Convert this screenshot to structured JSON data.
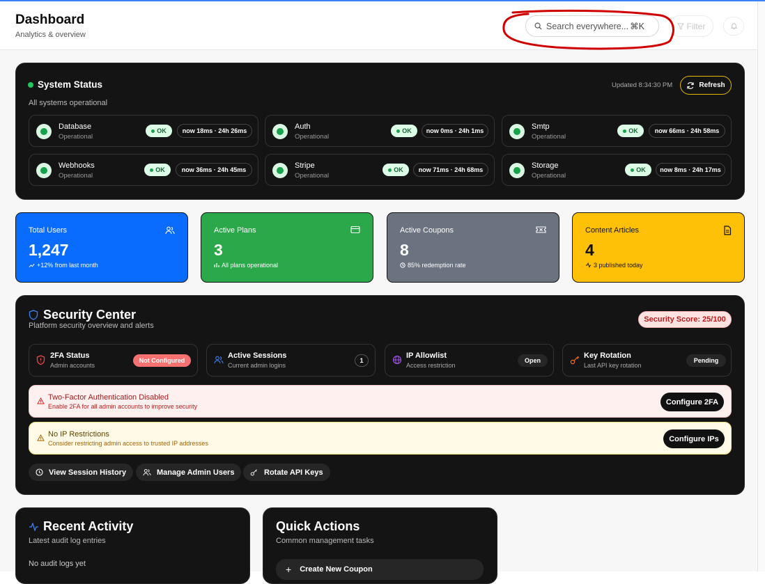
{
  "header": {
    "title": "Dashboard",
    "subtitle": "Analytics & overview",
    "search_placeholder": "Search everywhere...",
    "search_shortcut": "⌘K",
    "filter_label": "Filter"
  },
  "system_status": {
    "title": "System Status",
    "subtitle": "All systems operational",
    "updated": "Updated 8:34:30 PM",
    "refresh_label": "Refresh",
    "services": [
      {
        "name": "Database",
        "status": "Operational",
        "badge": "OK",
        "latency": "now 18ms · 24h 26ms"
      },
      {
        "name": "Auth",
        "status": "Operational",
        "badge": "OK",
        "latency": "now 0ms · 24h 1ms"
      },
      {
        "name": "Smtp",
        "status": "Operational",
        "badge": "OK",
        "latency": "now 66ms · 24h 58ms"
      },
      {
        "name": "Webhooks",
        "status": "Operational",
        "badge": "OK",
        "latency": "now 36ms · 24h 45ms"
      },
      {
        "name": "Stripe",
        "status": "Operational",
        "badge": "OK",
        "latency": "now 71ms · 24h 68ms"
      },
      {
        "name": "Storage",
        "status": "Operational",
        "badge": "OK",
        "latency": "now 8ms · 24h 17ms"
      }
    ]
  },
  "stats": [
    {
      "label": "Total Users",
      "value": "1,247",
      "footer": "+12% from last month",
      "icon": "users-icon",
      "color": "#0a6cff"
    },
    {
      "label": "Active Plans",
      "value": "3",
      "footer": "All plans operational",
      "icon": "credit-card-icon",
      "color": "#2aa84a"
    },
    {
      "label": "Active Coupons",
      "value": "8",
      "footer": "85% redemption rate",
      "icon": "ticket-icon",
      "color": "#6b7280"
    },
    {
      "label": "Content Articles",
      "value": "4",
      "footer": "3 published today",
      "icon": "document-icon",
      "color": "#ffc107"
    }
  ],
  "security": {
    "title": "Security Center",
    "subtitle": "Platform security overview and alerts",
    "score": "Security Score: 25/100",
    "tiles": [
      {
        "title": "2FA Status",
        "sub": "Admin accounts",
        "badge": "Not Configured"
      },
      {
        "title": "Active Sessions",
        "sub": "Current admin logins",
        "badge": "1"
      },
      {
        "title": "IP Allowlist",
        "sub": "Access restriction",
        "badge": "Open"
      },
      {
        "title": "Key Rotation",
        "sub": "Last API key rotation",
        "badge": "Pending"
      }
    ],
    "alerts": [
      {
        "title": "Two-Factor Authentication Disabled",
        "sub": "Enable 2FA for all admin accounts to improve security",
        "button": "Configure 2FA"
      },
      {
        "title": "No IP Restrictions",
        "sub": "Consider restricting admin access to trusted IP addresses",
        "button": "Configure IPs"
      }
    ],
    "actions": [
      "View Session History",
      "Manage Admin Users",
      "Rotate API Keys"
    ]
  },
  "recent_activity": {
    "title": "Recent Activity",
    "subtitle": "Latest audit log entries",
    "empty": "No audit logs yet"
  },
  "quick_actions": {
    "title": "Quick Actions",
    "subtitle": "Common management tasks",
    "first": "Create New Coupon"
  }
}
